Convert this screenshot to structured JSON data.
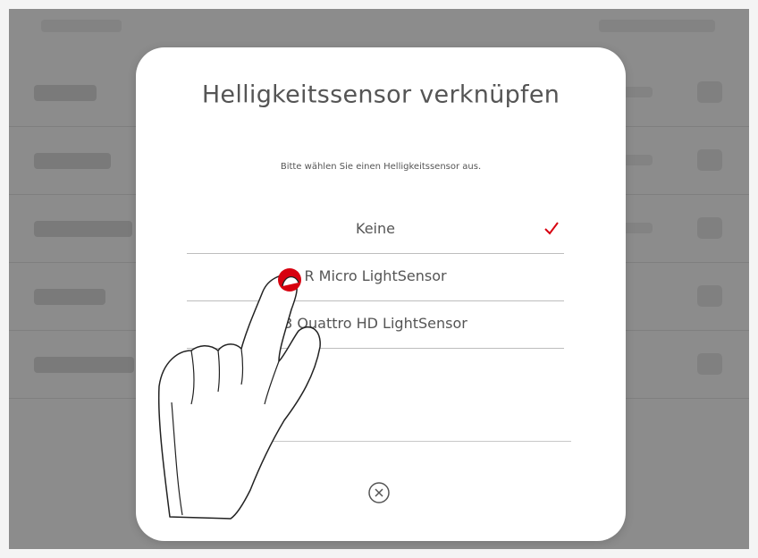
{
  "dialog": {
    "title": "Helligkeitssensor verknüpfen",
    "subtitle": "Bitte wählen Sie einen Helligkeitssensor aus.",
    "options": [
      {
        "label": "Keine",
        "selected": true
      },
      {
        "label": "R Micro LightSensor",
        "selected": false
      },
      {
        "label": "3 Quattro HD LightSensor",
        "selected": false
      }
    ],
    "close_icon": "close-circle-icon"
  },
  "colors": {
    "accent": "#d7000f",
    "overlay": "#8c8c8c",
    "text": "#555555"
  },
  "overlay_touch": {
    "icon": "pointing-hand-icon",
    "touch_marker_color": "#d7000f"
  }
}
